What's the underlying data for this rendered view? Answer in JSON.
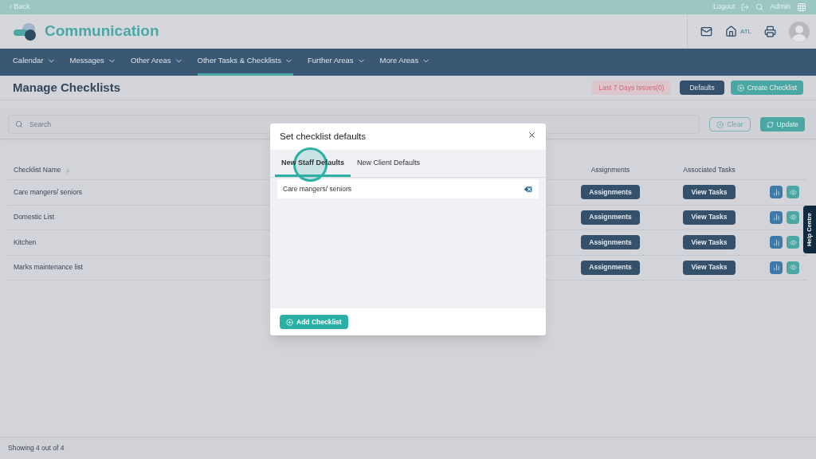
{
  "top_bar": {
    "back": "‹ Back",
    "logout": "Logout",
    "user": "Admin"
  },
  "header": {
    "app_title": "Communication",
    "home_label": "ATL"
  },
  "nav": [
    {
      "label": "Calendar",
      "selected": false
    },
    {
      "label": "Messages",
      "selected": false
    },
    {
      "label": "Other Areas",
      "selected": false
    },
    {
      "label": "Other Tasks & Checklists",
      "selected": true
    },
    {
      "label": "Further Areas",
      "selected": false
    },
    {
      "label": "More Areas",
      "selected": false
    }
  ],
  "page": {
    "title": "Manage Checklists",
    "issues_button": "Last 7 Days Issues(0)",
    "defaults_button": "Defaults",
    "create_button": "Create Checklist"
  },
  "search": {
    "placeholder": "Search",
    "clear_button": "Clear",
    "update_button": "Update"
  },
  "table": {
    "columns": [
      "Checklist Name",
      "Assignments",
      "Associated Tasks"
    ],
    "rows": [
      {
        "name": "Care mangers/ seniors",
        "assignments": "Assignments",
        "tasks": "View Tasks"
      },
      {
        "name": "Domestic List",
        "assignments": "Assignments",
        "tasks": "View Tasks"
      },
      {
        "name": "Kitchen",
        "assignments": "Assignments",
        "tasks": "View Tasks"
      },
      {
        "name": "Marks maintenance list",
        "assignments": "Assignments",
        "tasks": "View Tasks"
      }
    ]
  },
  "footer": {
    "count": "Showing 4 out of 4"
  },
  "help_tab": "Help Centre",
  "dialog": {
    "title": "Set checklist defaults",
    "tabs": [
      {
        "label": "New Staff Defaults",
        "selected": true
      },
      {
        "label": "New Client Defaults",
        "selected": false
      }
    ],
    "items": [
      "Care mangers/ seniors"
    ],
    "add_button": "Add Checklist"
  }
}
